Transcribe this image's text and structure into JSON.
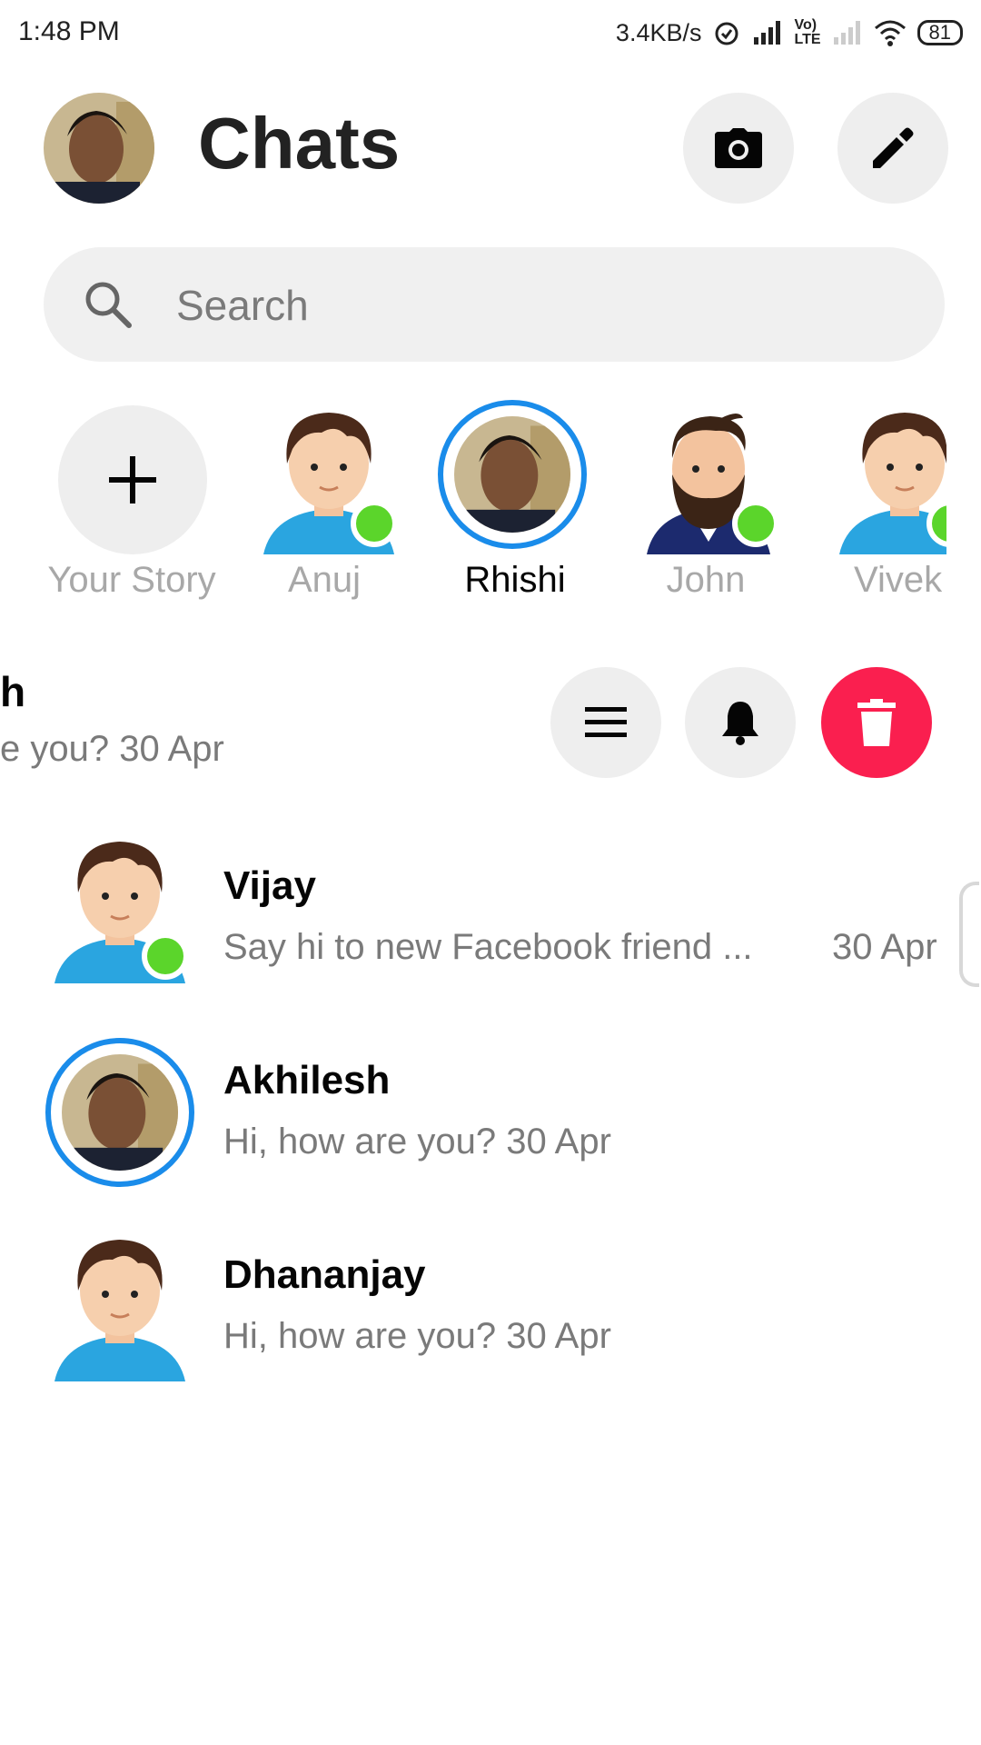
{
  "status_bar": {
    "time": "1:48 PM",
    "network_speed": "3.4KB/s",
    "volte": "Vo)\nLTE",
    "battery": "81",
    "icons": [
      "alarm-icon",
      "signal-icon",
      "volte-icon",
      "signal-weak-icon",
      "wifi-icon",
      "battery-icon"
    ]
  },
  "header": {
    "title": "Chats",
    "camera_icon": "camera-icon",
    "compose_icon": "compose-icon"
  },
  "search": {
    "placeholder": "Search"
  },
  "stories": [
    {
      "name": "Your Story",
      "type": "add",
      "online": false
    },
    {
      "name": "Anuj",
      "type": "cartoon",
      "online": true
    },
    {
      "name": "Rhishi",
      "type": "photo",
      "online": false,
      "active_ring": true
    },
    {
      "name": "John",
      "type": "bearded",
      "online": true
    },
    {
      "name": "Vivek",
      "type": "cartoon",
      "online": true
    }
  ],
  "swiped_row": {
    "name_fragment": "h",
    "message_fragment": "e you? 30 Apr",
    "actions": [
      "menu-icon",
      "bell-icon",
      "trash-icon"
    ]
  },
  "chats": [
    {
      "name": "Vijay",
      "message": "Say hi to new Facebook friend ...",
      "time": "30 Apr",
      "online": true
    },
    {
      "name": "Akhilesh",
      "message": "Hi, how are you? 30 Apr",
      "time": "",
      "online": false
    },
    {
      "name": "Dhananjay",
      "message": "Hi, how are you? 30 Apr",
      "time": "",
      "online": false
    }
  ],
  "colors": {
    "accent_blue": "#1a8cea",
    "online_green": "#5bd52b",
    "delete_red": "#fa1f4f",
    "button_bg": "#eeeeee"
  }
}
